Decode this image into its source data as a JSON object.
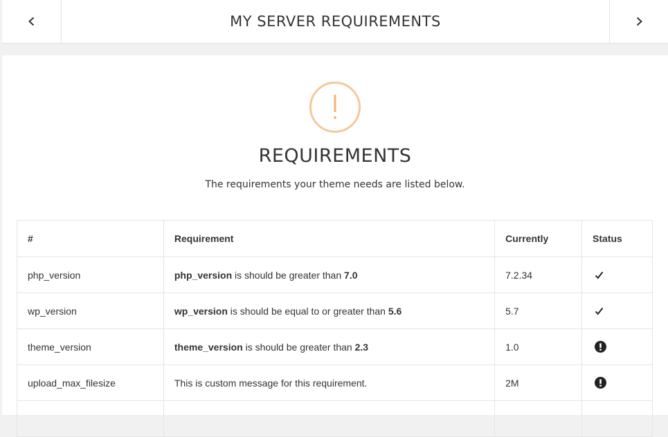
{
  "header": {
    "title": "MY SERVER REQUIREMENTS"
  },
  "main": {
    "heading": "REQUIREMENTS",
    "subheading": "The requirements your theme needs are listed below."
  },
  "table": {
    "columns": [
      "#",
      "Requirement",
      "Currently",
      "Status"
    ],
    "rows": [
      {
        "name": "php_version",
        "req_key": "php_version",
        "req_text": " is should be greater than ",
        "req_value": "7.0",
        "currently": "7.2.34",
        "status": "check"
      },
      {
        "name": "wp_version",
        "req_key": "wp_version",
        "req_text": " is should be equal to or greater than ",
        "req_value": "5.6",
        "currently": "5.7",
        "status": "check"
      },
      {
        "name": "theme_version",
        "req_key": "theme_version",
        "req_text": " is should be greater than ",
        "req_value": "2.3",
        "currently": "1.0",
        "status": "warning"
      },
      {
        "name": "upload_max_filesize",
        "req_message": "This is custom message for this requirement.",
        "currently": "2M",
        "status": "warning"
      }
    ]
  },
  "colors": {
    "warning_ring": "#f6c79a",
    "warning_mark": "#f4b27a",
    "text": "#333333"
  },
  "icons": {
    "prev": "chevron-left-icon",
    "next": "chevron-right-icon",
    "alert": "exclamation-circle-icon",
    "check": "check-icon"
  }
}
